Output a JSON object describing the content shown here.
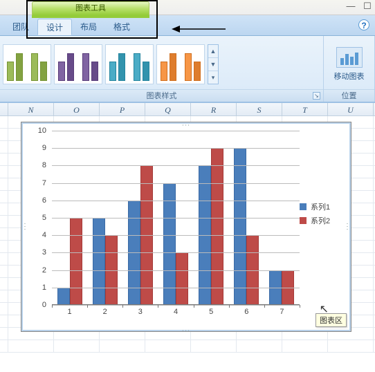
{
  "context_tab": "图表工具",
  "tabs": {
    "team": "团队",
    "design": "设计",
    "layout": "布局",
    "format": "格式"
  },
  "ribbon": {
    "styles_label": "图表样式",
    "location_label": "位置",
    "move_chart_label": "移动图表",
    "style_colors": [
      [
        "#9CBB5A",
        "#9CBB5A"
      ],
      [
        "#8064A2",
        "#8064A2"
      ],
      [
        "#4BACC6",
        "#4BACC6"
      ],
      [
        "#F79646",
        "#F79646"
      ]
    ]
  },
  "columns": [
    "N",
    "O",
    "P",
    "Q",
    "R",
    "S",
    "T",
    "U"
  ],
  "chart_tooltip": "图表区",
  "legend": {
    "s1": "系列1",
    "s2": "系列2"
  },
  "colors": {
    "s1": "#4a7ebb",
    "s2": "#be4b48"
  },
  "chart_data": {
    "type": "bar",
    "categories": [
      "1",
      "2",
      "3",
      "4",
      "5",
      "6",
      "7"
    ],
    "series": [
      {
        "name": "系列1",
        "values": [
          1,
          5,
          6,
          7,
          8,
          9,
          2
        ]
      },
      {
        "name": "系列2",
        "values": [
          5,
          4,
          8,
          3,
          9,
          4,
          2
        ]
      }
    ],
    "ylim": [
      0,
      10
    ],
    "yticks": [
      0,
      1,
      2,
      3,
      4,
      5,
      6,
      7,
      8,
      9,
      10
    ],
    "xlabel": "",
    "ylabel": "",
    "title": ""
  }
}
